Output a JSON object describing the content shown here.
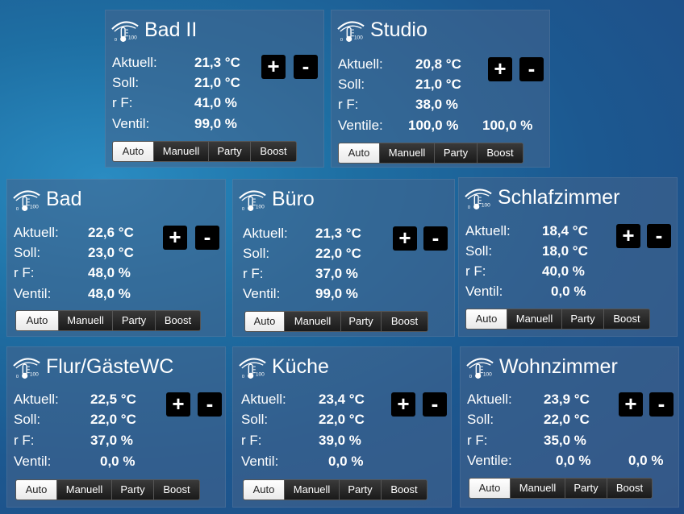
{
  "labels": {
    "aktuell": "Aktuell:",
    "soll": "Soll:",
    "rf": "r F:",
    "ventil": "Ventil:",
    "ventile": "Ventile:",
    "plus": "+",
    "minus": "-",
    "auto": "Auto",
    "manuell": "Manuell",
    "party": "Party",
    "boost": "Boost"
  },
  "selected_mode": "Auto",
  "rooms": [
    {
      "name": "Bad II",
      "aktuell": "21,3 °C",
      "soll": "21,0 °C",
      "rf": "41,0 %",
      "ventil": "99,0 %"
    },
    {
      "name": "Studio",
      "aktuell": "20,8 °C",
      "soll": "21,0 °C",
      "rf": "38,0 %",
      "ventil": "100,0 %",
      "ventil2": "100,0 %"
    },
    {
      "name": "Bad",
      "aktuell": "22,6 °C",
      "soll": "23,0 °C",
      "rf": "48,0 %",
      "ventil": "48,0 %"
    },
    {
      "name": "Büro",
      "aktuell": "21,3 °C",
      "soll": "22,0 °C",
      "rf": "37,0 %",
      "ventil": "99,0 %"
    },
    {
      "name": "Schlafzimmer",
      "aktuell": "18,4 °C",
      "soll": "18,0 °C",
      "rf": "40,0 %",
      "ventil": "0,0 %"
    },
    {
      "name": "Flur/GästeWC",
      "aktuell": "22,5 °C",
      "soll": "22,0 °C",
      "rf": "37,0 %",
      "ventil": "0,0 %"
    },
    {
      "name": "Küche",
      "aktuell": "23,4 °C",
      "soll": "22,0 °C",
      "rf": "39,0 %",
      "ventil": "0,0 %"
    },
    {
      "name": "Wohnzimmer",
      "aktuell": "23,9 °C",
      "soll": "22,0 °C",
      "rf": "35,0 %",
      "ventil": "0,0 %",
      "ventil2": "0,0 %"
    }
  ]
}
